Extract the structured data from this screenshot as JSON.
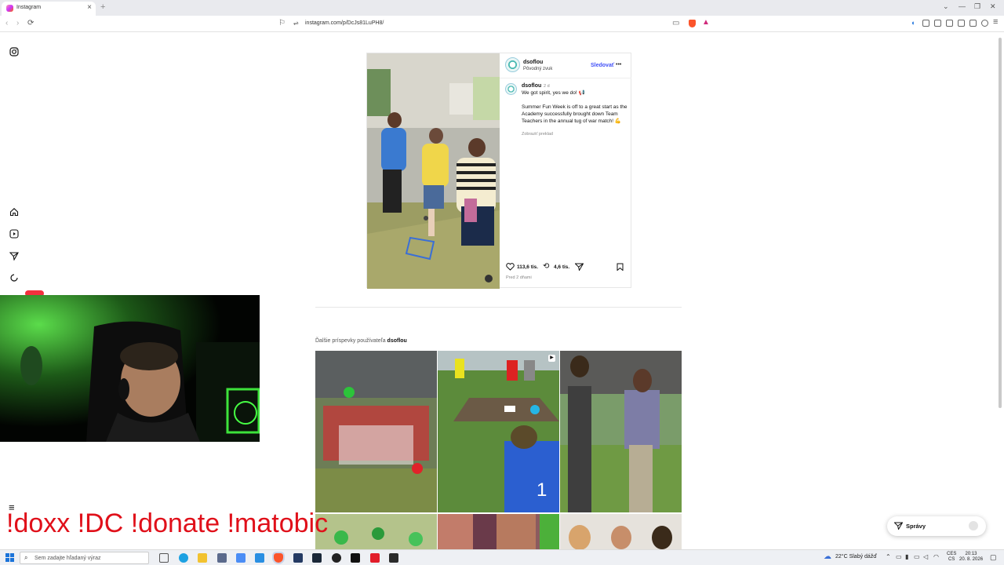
{
  "browser": {
    "tab_title": "Instagram",
    "new_tab": "+",
    "close": "×",
    "url": "instagram.com/p/DcJs81LuPH8/"
  },
  "post": {
    "author": "dsoflou",
    "audio": "Pôvodný zvuk",
    "follow_label": "Sledovať",
    "more_label": "•••",
    "comment_author": "dsoflou",
    "comment_age": "2 d",
    "caption_line1": "We got spirit, yes we do! 📢",
    "caption_body": "Summer Fun Week is off to a great start as the Academy successfully brought down Team Teachers in the annual tug of war match! 💪",
    "translate_label": "Zobraziť preklad",
    "likes": "113,6 tis.",
    "reposts": "4,6 tis.",
    "posted": "Pred 2 dňami"
  },
  "more_posts": {
    "label": "Ďalšie príspevky používateľa",
    "user": "dsoflou"
  },
  "overlay": {
    "commands": "!doxx  !DC !donate !matobic"
  },
  "messages": {
    "label": "Správy"
  },
  "taskbar": {
    "search_placeholder": "Sem zadajte hľadaný výraz",
    "weather": "22°C  Slabý dážď",
    "lang_top": "CES",
    "lang_bottom": "CS",
    "time": "20:13",
    "date": "20. 8. 2026"
  },
  "colors": {
    "accent_blue": "#0095f6",
    "follow_blue": "#4150f7",
    "overlay_red": "#e0101a"
  }
}
